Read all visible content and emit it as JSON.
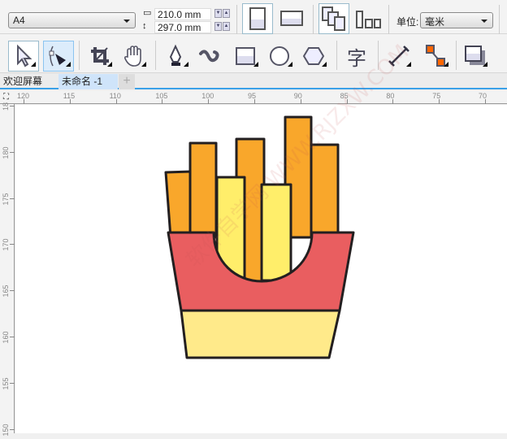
{
  "property_bar": {
    "page_size": "A4",
    "width": "210.0 mm",
    "height": "297.0 mm",
    "units_label": "单位:",
    "units_value": "毫米"
  },
  "tabs": [
    {
      "label": "欢迎屏幕"
    },
    {
      "label": "未命名 -1"
    }
  ],
  "add_tab": "+",
  "ruler_h": [
    "120",
    "115",
    "110",
    "105",
    "100",
    "95",
    "90",
    "85",
    "80",
    "75",
    "70"
  ],
  "ruler_v": [
    "18",
    "180",
    "175",
    "170",
    "165",
    "160",
    "155",
    "150"
  ],
  "watermark": "软件自学网 WWW.RJZXW.COM",
  "colors": {
    "orange": "#F9A72B",
    "yellow": "#FFEE6A",
    "red": "#E95E60",
    "cream": "#FFEA8A",
    "stroke": "#231F20"
  }
}
